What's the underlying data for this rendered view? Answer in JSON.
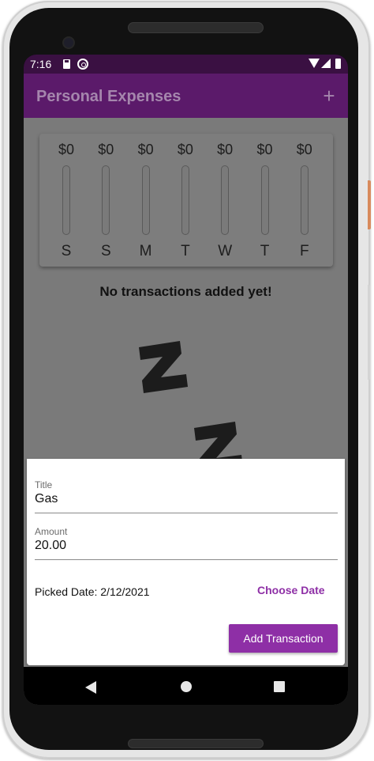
{
  "status_bar": {
    "time": "7:16",
    "icons": [
      "sim-card-icon",
      "sync-icon",
      "wifi-icon",
      "signal-icon",
      "battery-icon"
    ]
  },
  "app_bar": {
    "title": "Personal Expenses",
    "action_icon": "add-icon",
    "action_glyph": "+"
  },
  "chart": {
    "bars": [
      {
        "day": "S",
        "amount": "$0",
        "fill_fraction": 0
      },
      {
        "day": "S",
        "amount": "$0",
        "fill_fraction": 0
      },
      {
        "day": "M",
        "amount": "$0",
        "fill_fraction": 0
      },
      {
        "day": "T",
        "amount": "$0",
        "fill_fraction": 0
      },
      {
        "day": "W",
        "amount": "$0",
        "fill_fraction": 0
      },
      {
        "day": "T",
        "amount": "$0",
        "fill_fraction": 0
      },
      {
        "day": "F",
        "amount": "$0",
        "fill_fraction": 0
      }
    ]
  },
  "empty_state": {
    "message": "No transactions added yet!",
    "image_icon": "sleeping-zzz-image"
  },
  "new_transaction_form": {
    "title_field": {
      "label": "Title",
      "value": "Gas"
    },
    "amount_field": {
      "label": "Amount",
      "value": "20.00"
    },
    "picked_date": "Picked Date: 2/12/2021",
    "choose_date_label": "Choose Date",
    "submit_label": "Add Transaction"
  },
  "colors": {
    "primary": "#8e2fa6",
    "app_bar": "#5b1a6a",
    "status_bar": "#3a1042",
    "scrim": "#7a7a7a"
  },
  "nav_bar": {
    "icons": [
      "back-icon",
      "home-icon",
      "recents-icon"
    ]
  }
}
